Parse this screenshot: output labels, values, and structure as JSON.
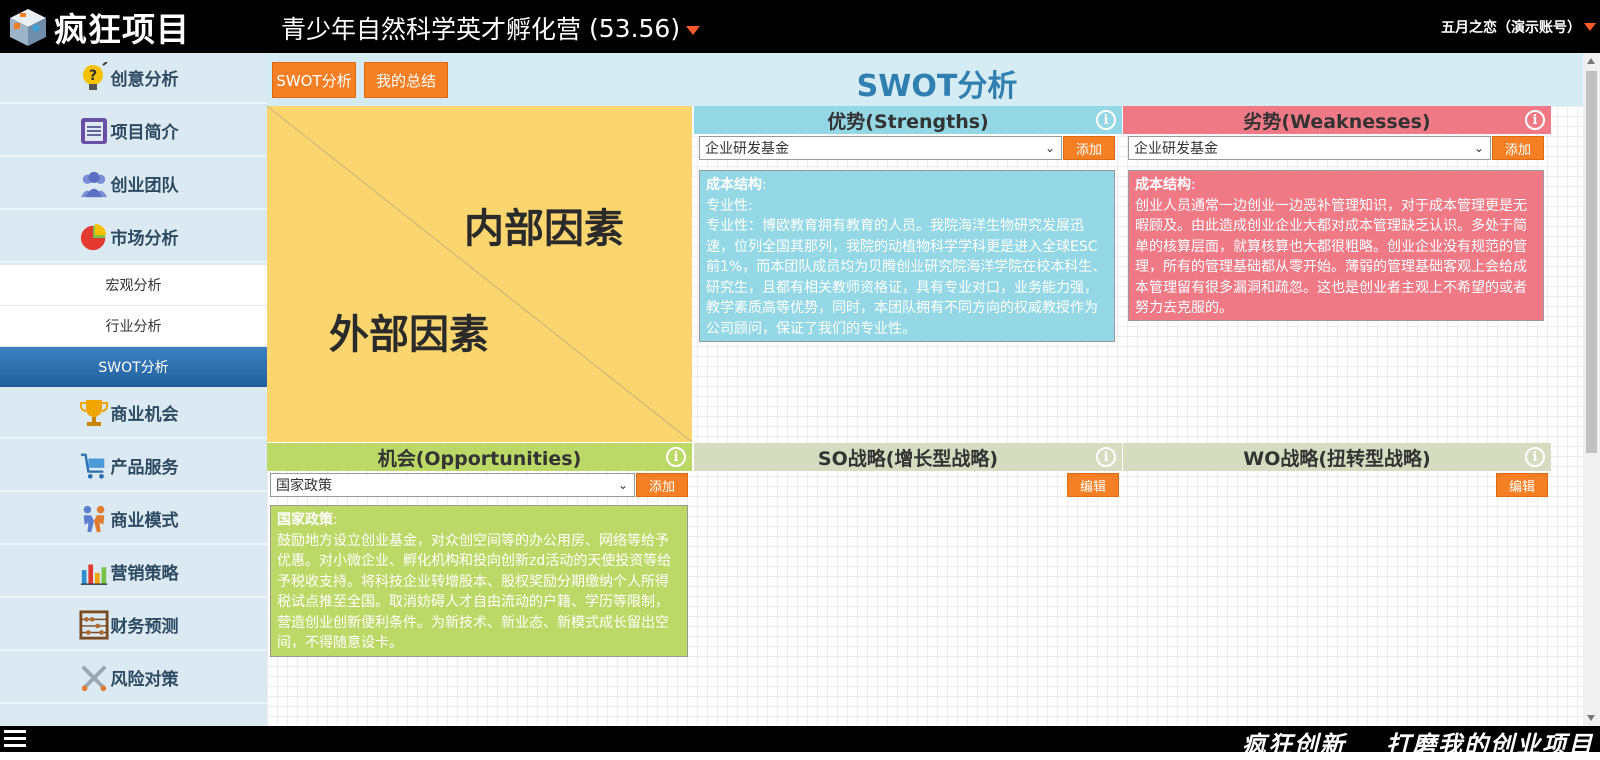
{
  "topbar": {
    "logo_text": "疯狂项目",
    "project_title": "青少年自然科学英才孵化营",
    "project_score": "(53.56)",
    "account": "五月之恋（演示账号）"
  },
  "sidebar": {
    "items": [
      {
        "label": "创意分析",
        "icon": "lightbulb-question-icon"
      },
      {
        "label": "项目简介",
        "icon": "document-icon"
      },
      {
        "label": "创业团队",
        "icon": "team-icon"
      },
      {
        "label": "市场分析",
        "icon": "pie-chart-icon"
      },
      {
        "label": "商业机会",
        "icon": "trophy-icon"
      },
      {
        "label": "产品服务",
        "icon": "cart-icon"
      },
      {
        "label": "商业模式",
        "icon": "handshake-icon"
      },
      {
        "label": "营销策略",
        "icon": "bar-chart-icon"
      },
      {
        "label": "财务预测",
        "icon": "abacus-icon"
      },
      {
        "label": "风险对策",
        "icon": "crossed-swords-icon"
      }
    ],
    "sub_items": [
      {
        "label": "宏观分析"
      },
      {
        "label": "行业分析"
      },
      {
        "label": "SWOT分析"
      }
    ]
  },
  "header": {
    "btn_swot": "SWOT分析",
    "btn_summary": "我的总结",
    "title": "SWOT分析"
  },
  "quadrant": {
    "internal": "内部因素",
    "external": "外部因素"
  },
  "strengths": {
    "title": "优势(Strengths)",
    "select": "企业研发基金",
    "add": "添加",
    "heading": "成本结构",
    "line1": "专业性:",
    "body": "专业性：博欧教育拥有教育的人员。我院海洋生物研究发展迅速，位列全国其那列，我院的动植物科学学科更是进入全球ESC前1%，而本团队成员均为贝腾创业研究院海洋学院在校本科生、研究生，且都有相关教师资格证，具有专业对口，业务能力强，教学素质高等优势，同时，本团队拥有不同方向的权威教授作为公司顾问，保证了我们的专业性。",
    "color": "#93d8e4"
  },
  "weaknesses": {
    "title": "劣势(Weaknesses)",
    "select": "企业研发基金",
    "add": "添加",
    "heading": "成本结构",
    "body": "创业人员通常一边创业一边恶补管理知识，对于成本管理更是无暇顾及。由此造成创业企业大都对成本管理缺乏认识。多处于简单的核算层面，就算核算也大都很粗略。创业企业没有规范的管理，所有的管理基础都从零开始。薄弱的管理基础客观上会给成本管理留有很多漏洞和疏忽。这也是创业者主观上不希望的或者努力去克服的。",
    "color": "#ef7a86"
  },
  "opportunities": {
    "title": "机会(Opportunities)",
    "select": "国家政策",
    "add": "添加",
    "heading": "国家政策",
    "body": "鼓励地方设立创业基金，对众创空间等的办公用房、网络等给予优惠。对小微企业、孵化机构和投向创新zd活动的天使投资等给予税收支持。将科技企业转增股本、股权奖励分期缴纳个人所得税试点推至全国。取消妨碍人才自由流动的户籍、学历等限制，营造创业创新便利条件。为新技术、新业态、新模式成长留出空间，不得随意设卡。",
    "color": "#bcd967"
  },
  "so": {
    "title": "SO战略(增长型战略)",
    "edit": "编辑"
  },
  "wo": {
    "title": "WO战略(扭转型战略)",
    "edit": "编辑"
  },
  "bottombar": {
    "slogan1": "疯狂创新",
    "slogan2": "打磨我的创业项目"
  },
  "colors": {
    "accent_orange": "#f47f24",
    "active_nav": "#2a6ca9",
    "title_blue": "#2f7fb0",
    "quadrant_yellow": "#fbd56e"
  }
}
